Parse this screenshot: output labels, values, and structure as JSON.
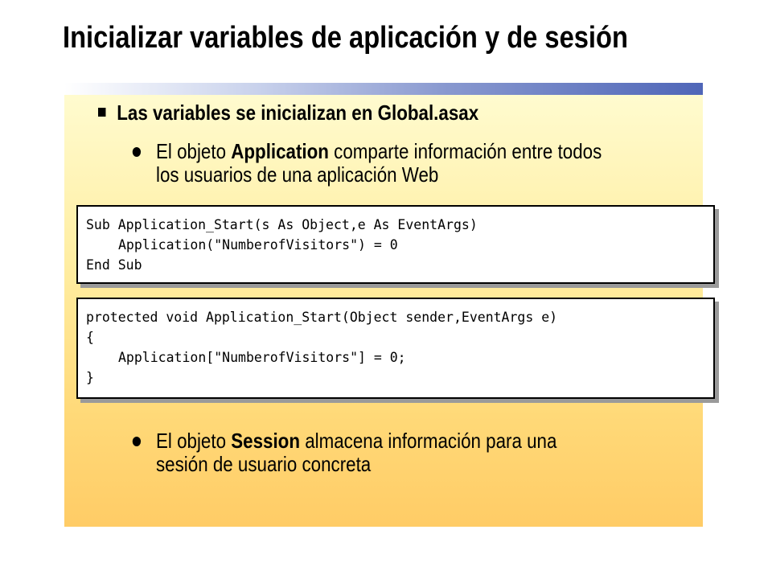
{
  "slide": {
    "title": "Inicializar variables de aplicación y de sesión"
  },
  "bullets": {
    "main": "Las variables se inicializan en Global.asax",
    "application": {
      "prefix": "El objeto ",
      "keyword": "Application",
      "line1_rest": " comparte información entre todos",
      "line2": "los usuarios de una aplicación Web"
    },
    "session": {
      "prefix": "El objeto ",
      "keyword": "Session",
      "line1_rest": " almacena información para una",
      "line2": "sesión de usuario concreta"
    }
  },
  "code_vb": {
    "lines": [
      "Sub Application_Start(s As Object,e As EventArgs)",
      "Application(\"NumberofVisitors\") = 0",
      "End Sub"
    ]
  },
  "code_cs": {
    "lines": [
      "protected void Application_Start(Object sender,EventArgs e)",
      "{",
      "Application[\"NumberofVisitors\"] = 0;",
      "}"
    ]
  },
  "colors": {
    "panel_top": "#fffcd2",
    "panel_bottom": "#ffcc66",
    "bar_accent": "#4f66b8",
    "code_shadow": "#9a9a9a"
  }
}
